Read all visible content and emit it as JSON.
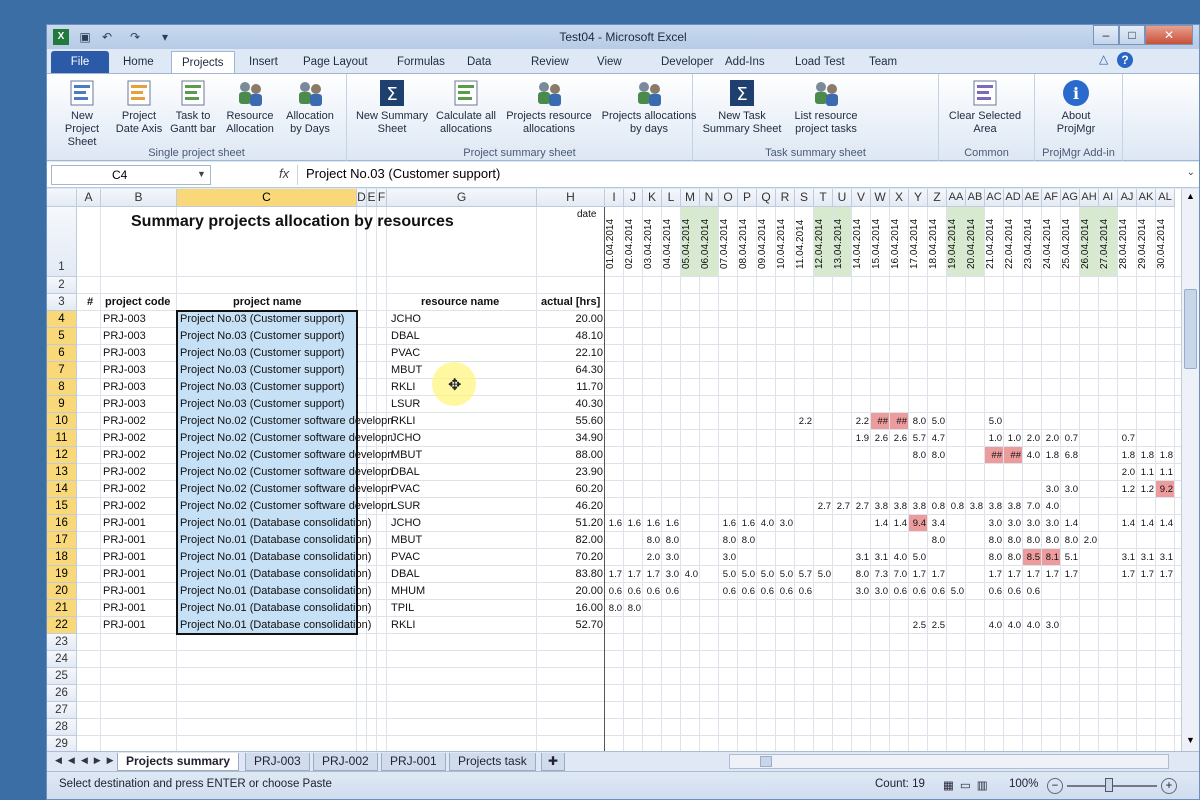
{
  "window": {
    "title": "Test04  -  Microsoft Excel",
    "minimize": "–",
    "maximize": "□",
    "close": "✕"
  },
  "tabs": [
    "File",
    "Home",
    "Projects",
    "Insert",
    "Page Layout",
    "Formulas",
    "Data",
    "Review",
    "View",
    "Developer",
    "Add-Ins",
    "Load Test",
    "Team"
  ],
  "active_tab": "Projects",
  "ribbon": {
    "groups": [
      {
        "label": "Single project sheet",
        "buttons": [
          "New Project Sheet",
          "Project Date Axis",
          "Task to Gantt bar",
          "Resource Allocation",
          "Allocation by Days"
        ]
      },
      {
        "label": "Project summary sheet",
        "buttons": [
          "New Summary Sheet",
          "Calculate all allocations",
          "Projects resource allocations",
          "Projects allocations by days"
        ]
      },
      {
        "label": "Task summary sheet",
        "buttons": [
          "New Task Summary Sheet",
          "List resource project tasks"
        ]
      },
      {
        "label": "Common",
        "buttons": [
          "Clear Selected Area"
        ]
      },
      {
        "label": "ProjMgr Add-in",
        "buttons": [
          "About ProjMgr"
        ]
      }
    ]
  },
  "formula_bar": {
    "name_box": "C4",
    "fx": "fx",
    "formula": "Project No.03 (Customer support)"
  },
  "columns": [
    "A",
    "B",
    "C",
    "D",
    "E",
    "F",
    "G",
    "H",
    "I",
    "J",
    "K",
    "L",
    "M",
    "N",
    "O",
    "P",
    "Q",
    "R",
    "S",
    "T",
    "U",
    "V",
    "W",
    "X",
    "Y",
    "Z",
    "AA",
    "AB",
    "AC",
    "AD",
    "AE",
    "AF",
    "AG",
    "AH",
    "AI",
    "AJ",
    "AK",
    "AL"
  ],
  "sheet": {
    "title": "Summary projects allocation by resources",
    "date_label": "date",
    "headers": {
      "num": "#",
      "code": "project code",
      "name": "project name",
      "resource": "resource name",
      "actual": "actual [hrs]"
    },
    "dates": [
      "01.04.2014",
      "02.04.2014",
      "03.04.2014",
      "04.04.2014",
      "05.04.2014",
      "06.04.2014",
      "07.04.2014",
      "08.04.2014",
      "09.04.2014",
      "10.04.2014",
      "11.04.2014",
      "12.04.2014",
      "13.04.2014",
      "14.04.2014",
      "15.04.2014",
      "16.04.2014",
      "17.04.2014",
      "18.04.2014",
      "19.04.2014",
      "20.04.2014",
      "21.04.2014",
      "22.04.2014",
      "23.04.2014",
      "24.04.2014",
      "25.04.2014",
      "26.04.2014",
      "27.04.2014",
      "28.04.2014",
      "29.04.2014",
      "30.04.2014"
    ],
    "rows": [
      {
        "code": "PRJ-003",
        "name": "Project No.03 (Customer support)",
        "res": "JCHO",
        "actual": "20.00",
        "v": {}
      },
      {
        "code": "PRJ-003",
        "name": "Project No.03 (Customer support)",
        "res": "DBAL",
        "actual": "48.10",
        "v": {}
      },
      {
        "code": "PRJ-003",
        "name": "Project No.03 (Customer support)",
        "res": "PVAC",
        "actual": "22.10",
        "v": {}
      },
      {
        "code": "PRJ-003",
        "name": "Project No.03 (Customer support)",
        "res": "MBUT",
        "actual": "64.30",
        "v": {}
      },
      {
        "code": "PRJ-003",
        "name": "Project No.03 (Customer support)",
        "res": "RKLI",
        "actual": "11.70",
        "v": {}
      },
      {
        "code": "PRJ-003",
        "name": "Project No.03 (Customer support)",
        "res": "LSUR",
        "actual": "40.30",
        "v": {}
      },
      {
        "code": "PRJ-002",
        "name": "Project No.02 (Customer software developme",
        "res": "RKLI",
        "actual": "55.60",
        "v": {
          "10": "2.2",
          "13": "2.2",
          "14": "##",
          "15": "##",
          "16": "8.0",
          "17": "5.0",
          "20": "5.0"
        }
      },
      {
        "code": "PRJ-002",
        "name": "Project No.02 (Customer software developme",
        "res": "JCHO",
        "actual": "34.90",
        "v": {
          "13": "1.9",
          "14": "2.6",
          "15": "2.6",
          "16": "5.7",
          "17": "4.7",
          "20": "1.0",
          "21": "1.0",
          "22": "2.0",
          "23": "2.0",
          "24": "0.7",
          "27": "0.7"
        }
      },
      {
        "code": "PRJ-002",
        "name": "Project No.02 (Customer software developme",
        "res": "MBUT",
        "actual": "88.00",
        "v": {
          "16": "8.0",
          "17": "8.0",
          "20": "##",
          "21": "##",
          "22": "4.0",
          "23": "1.8",
          "24": "6.8",
          "27": "1.8",
          "28": "1.8",
          "29": "1.8"
        }
      },
      {
        "code": "PRJ-002",
        "name": "Project No.02 (Customer software developme",
        "res": "DBAL",
        "actual": "23.90",
        "v": {
          "27": "2.0",
          "28": "1.1",
          "29": "1.1"
        }
      },
      {
        "code": "PRJ-002",
        "name": "Project No.02 (Customer software developme",
        "res": "PVAC",
        "actual": "60.20",
        "v": {
          "23": "3.0",
          "24": "3.0",
          "27": "1.2",
          "28": "1.2",
          "29": "9.2"
        }
      },
      {
        "code": "PRJ-002",
        "name": "Project No.02 (Customer software developme",
        "res": "LSUR",
        "actual": "46.20",
        "v": {
          "11": "2.7",
          "12": "2.7",
          "13": "2.7",
          "14": "3.8",
          "15": "3.8",
          "16": "3.8",
          "17": "0.8",
          "18": "0.8",
          "19": "3.8",
          "20": "3.8",
          "21": "3.8",
          "22": "7.0",
          "23": "4.0"
        }
      },
      {
        "code": "PRJ-001",
        "name": "Project No.01 (Database consolidation)",
        "res": "JCHO",
        "actual": "51.20",
        "v": {
          "0": "1.6",
          "1": "1.6",
          "2": "1.6",
          "3": "1.6",
          "6": "1.6",
          "7": "1.6",
          "8": "4.0",
          "9": "3.0",
          "14": "1.4",
          "15": "1.4",
          "16": "9.4",
          "17": "3.4",
          "20": "3.0",
          "21": "3.0",
          "22": "3.0",
          "23": "3.0",
          "24": "1.4",
          "27": "1.4",
          "28": "1.4",
          "29": "1.4"
        }
      },
      {
        "code": "PRJ-001",
        "name": "Project No.01 (Database consolidation)",
        "res": "MBUT",
        "actual": "82.00",
        "v": {
          "2": "8.0",
          "3": "8.0",
          "6": "8.0",
          "7": "8.0",
          "17": "8.0",
          "20": "8.0",
          "21": "8.0",
          "22": "8.0",
          "23": "8.0",
          "24": "8.0",
          "25": "2.0"
        }
      },
      {
        "code": "PRJ-001",
        "name": "Project No.01 (Database consolidation)",
        "res": "PVAC",
        "actual": "70.20",
        "v": {
          "2": "2.0",
          "3": "3.0",
          "6": "3.0",
          "13": "3.1",
          "14": "3.1",
          "15": "4.0",
          "16": "5.0",
          "20": "8.0",
          "21": "8.0",
          "22": "8.5",
          "23": "8.1",
          "24": "5.1",
          "27": "3.1",
          "28": "3.1",
          "29": "3.1"
        }
      },
      {
        "code": "PRJ-001",
        "name": "Project No.01 (Database consolidation)",
        "res": "DBAL",
        "actual": "83.80",
        "v": {
          "0": "1.7",
          "1": "1.7",
          "2": "1.7",
          "3": "3.0",
          "4": "4.0",
          "6": "5.0",
          "7": "5.0",
          "8": "5.0",
          "9": "5.0",
          "10": "5.7",
          "11": "5.0",
          "13": "8.0",
          "14": "7.3",
          "15": "7.0",
          "16": "1.7",
          "17": "1.7",
          "20": "1.7",
          "21": "1.7",
          "22": "1.7",
          "23": "1.7",
          "24": "1.7",
          "27": "1.7",
          "28": "1.7",
          "29": "1.7"
        }
      },
      {
        "code": "PRJ-001",
        "name": "Project No.01 (Database consolidation)",
        "res": "MHUM",
        "actual": "20.00",
        "v": {
          "0": "0.6",
          "1": "0.6",
          "2": "0.6",
          "3": "0.6",
          "6": "0.6",
          "7": "0.6",
          "8": "0.6",
          "9": "0.6",
          "10": "0.6",
          "13": "3.0",
          "14": "3.0",
          "15": "0.6",
          "16": "0.6",
          "17": "0.6",
          "18": "5.0",
          "20": "0.6",
          "21": "0.6",
          "22": "0.6"
        }
      },
      {
        "code": "PRJ-001",
        "name": "Project No.01 (Database consolidation)",
        "res": "TPIL",
        "actual": "16.00",
        "v": {
          "0": "8.0",
          "1": "8.0"
        }
      },
      {
        "code": "PRJ-001",
        "name": "Project No.01 (Database consolidation)",
        "res": "RKLI",
        "actual": "52.70",
        "v": {
          "16": "2.5",
          "17": "2.5",
          "20": "4.0",
          "21": "4.0",
          "22": "4.0",
          "23": "3.0"
        }
      }
    ],
    "red_cells": [
      [
        6,
        14
      ],
      [
        6,
        15
      ],
      [
        8,
        20
      ],
      [
        8,
        21
      ],
      [
        10,
        29
      ],
      [
        12,
        16
      ],
      [
        14,
        22
      ],
      [
        14,
        23
      ]
    ],
    "weekend_cols": [
      4,
      5,
      11,
      12,
      18,
      19,
      25,
      26
    ]
  },
  "sheet_tabs": [
    "Projects summary",
    "PRJ-003",
    "PRJ-002",
    "PRJ-001",
    "Projects task"
  ],
  "active_sheet": "Projects summary",
  "status": {
    "message": "Select destination and press ENTER or choose Paste",
    "count": "Count: 19",
    "zoom": "100%"
  }
}
